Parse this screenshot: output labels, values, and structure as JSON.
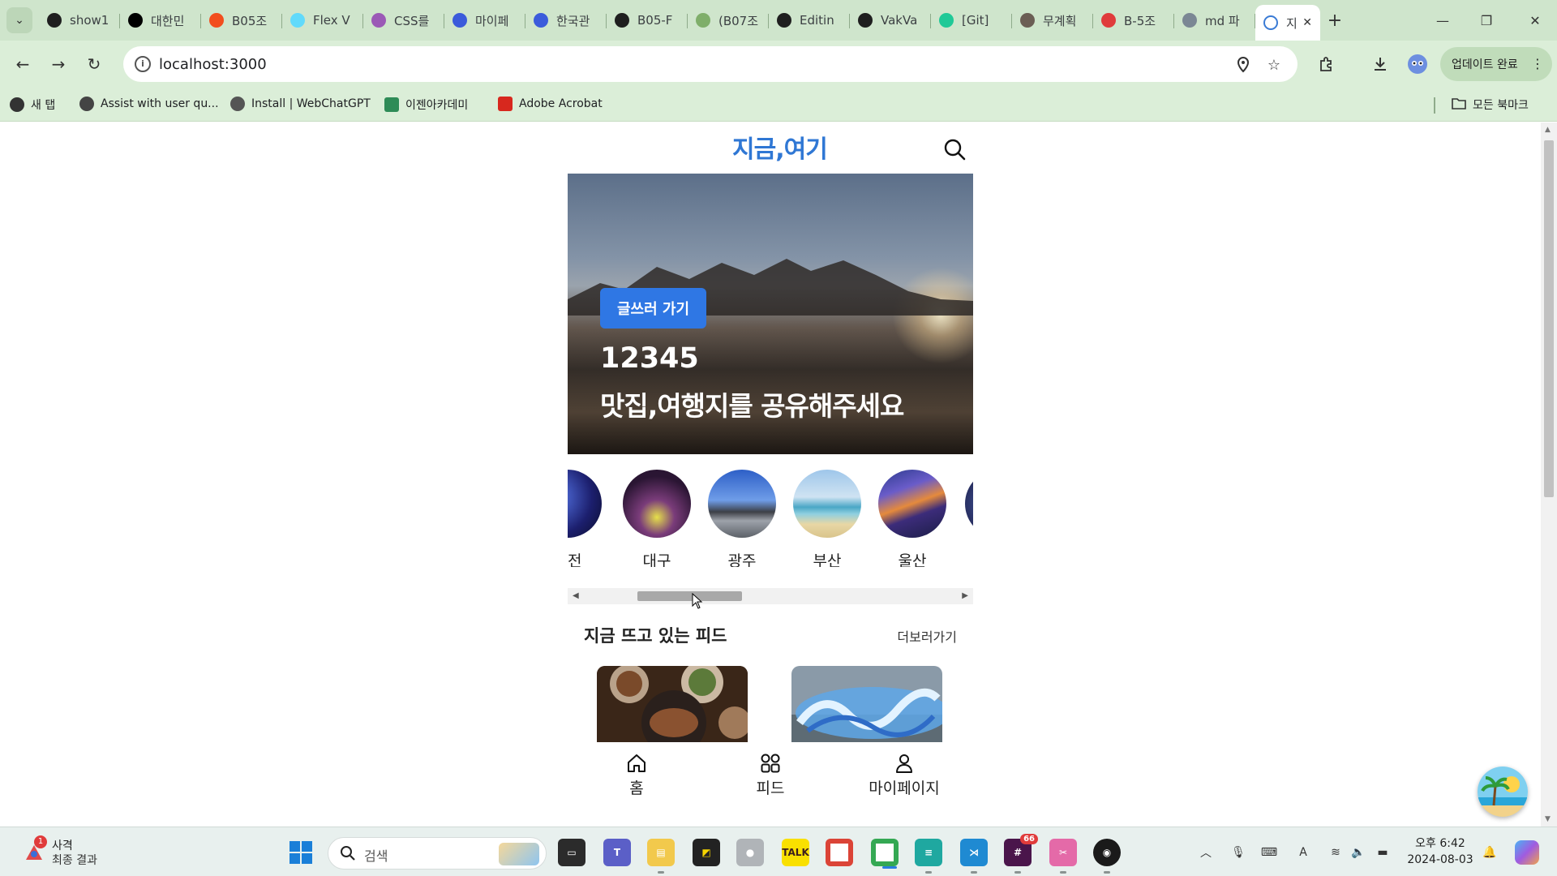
{
  "browser": {
    "tabs": [
      {
        "label": "show1",
        "icon": "github-icon",
        "color": "#1f1f1f"
      },
      {
        "label": "대한민",
        "icon": "infinity-icon",
        "color": "#000000"
      },
      {
        "label": "B05조",
        "icon": "figma-icon",
        "color": "#f24e1e"
      },
      {
        "label": "Flex V",
        "icon": "react-icon",
        "color": "#61dafb"
      },
      {
        "label": "CSS를",
        "icon": "ball-icon",
        "color": "#9b59b6"
      },
      {
        "label": "마이페",
        "icon": "d-icon",
        "color": "#3b5bdb"
      },
      {
        "label": "한국관",
        "icon": "d-icon",
        "color": "#3b5bdb"
      },
      {
        "label": "B05-F",
        "icon": "bolt-icon",
        "color": "#1f1f1f"
      },
      {
        "label": "(B07조",
        "icon": "leaf-icon",
        "color": "#7fae6a"
      },
      {
        "label": "Editin",
        "icon": "github-icon",
        "color": "#1f1f1f"
      },
      {
        "label": "VakVa",
        "icon": "vak-icon",
        "color": "#1f1f1f"
      },
      {
        "label": "[Git] ",
        "icon": "velog-icon",
        "color": "#20c997"
      },
      {
        "label": "무계획",
        "icon": "photo-icon",
        "color": "#6b5e54"
      },
      {
        "label": "B-5조",
        "icon": "heart-icon",
        "color": "#e03b3b"
      },
      {
        "label": "md 파",
        "icon": "globe-icon",
        "color": "#7b8794"
      }
    ],
    "active_tab": {
      "label": "지",
      "icon": "pin-icon"
    },
    "url": "localhost:3000",
    "update_label": "업데이트 완료",
    "bookmarks": [
      {
        "label": "새 탭",
        "icon": "chrome-icon",
        "color": "#333333"
      },
      {
        "label": "Assist with user qu...",
        "icon": "openai-icon",
        "color": "#444444"
      },
      {
        "label": "Install | WebChatGPT",
        "icon": "gpt-icon",
        "color": "#555555"
      },
      {
        "label": "이젠아카데미",
        "icon": "ezen-icon",
        "color": "#2e8b57"
      },
      {
        "label": "Adobe Acrobat",
        "icon": "acrobat-icon",
        "color": "#d7281e"
      }
    ],
    "all_bookmarks_label": "모든 북마크"
  },
  "app": {
    "logo": "지금,여기",
    "hero": {
      "button_label": "글쓰러 가기",
      "title": "12345",
      "subtitle": "맛집,여행지를 공유해주세요"
    },
    "regions": [
      {
        "name": "대전",
        "shown": "ㅐ전"
      },
      {
        "name": "대구"
      },
      {
        "name": "광주"
      },
      {
        "name": "부산"
      },
      {
        "name": "울산"
      }
    ],
    "feed": {
      "title": "지금 뜨고 있는 피드",
      "more_label": "더보러가기"
    },
    "bottom_nav": [
      {
        "label": "홈",
        "icon": "home-icon"
      },
      {
        "label": "피드",
        "icon": "grid-icon"
      },
      {
        "label": "마이페이지",
        "icon": "person-icon"
      }
    ]
  },
  "taskbar": {
    "weather_title": "사격",
    "weather_sub": "최종 결과",
    "weather_badge": "1",
    "search_placeholder": "검색",
    "slack_badge": "66",
    "clock_time": "오후 6:42",
    "clock_date": "2024-08-03"
  },
  "colors": {
    "brand": "#2f77d4",
    "write_button": "#2f77e4",
    "chrome_frame": "#cfe5cc"
  }
}
